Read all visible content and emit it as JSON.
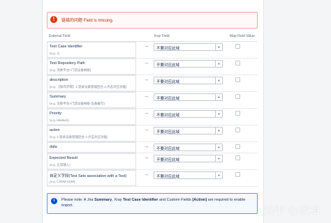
{
  "error": {
    "message": "链接的问题 Field is missing."
  },
  "header": {
    "external_field": "External Field",
    "xray_field": "Xray Field",
    "map_field_value": "Map Field Value"
  },
  "rows": [
    {
      "name": "Test Case Identifier",
      "hint": "(e.g. 1)",
      "select": "不要对应此域"
    },
    {
      "name": "Test Repository Path",
      "hint": "(e.g. 流象平台>门禁设备械板)",
      "select": "不要对应此域"
    },
    {
      "name": "description",
      "hint": "(e.g. 【操作步骤】1.登录设备管理后台 2.点击对应功能)",
      "select": "不要对应此域"
    },
    {
      "name": "Summary",
      "hint": "(e.g. 流象平台>门禁设备械板-设备编写)",
      "select": "不要对应此域"
    },
    {
      "name": "Priority",
      "hint": "(e.g. Medium)",
      "select": "不要对应此域"
    },
    {
      "name": "action",
      "hint": "(e.g. 1.登录设备管理后台 2.点击对应功能)",
      "select": "不要对应此域"
    },
    {
      "name": "data",
      "hint": "",
      "select": "不要对应此域"
    },
    {
      "name": "Expected Result",
      "hint": "(e.g. 正常输入)",
      "select": "不要对应此域"
    },
    {
      "name": "自定义字段(Test Sets association with a Test)",
      "hint": "(e.g. CSDM-4169)",
      "select": "不要对应此域"
    }
  ],
  "info": {
    "part1": "Please note: A Jira ",
    "summary": "Summary",
    "part2": ", Xray ",
    "identifier": "Test Case Identifier",
    "part3": " and Custom Fields ",
    "action": "[Action]",
    "part4": " are required to enable import."
  },
  "watermark": "知乎 @逻辑",
  "colors": {
    "error": "#de350b",
    "info": "#0052cc",
    "border": "#dfe1e6"
  },
  "icons": {
    "error": "error-icon",
    "info": "info-icon",
    "arrow": "arrow-right-icon",
    "caret": "chevron-down-icon"
  }
}
